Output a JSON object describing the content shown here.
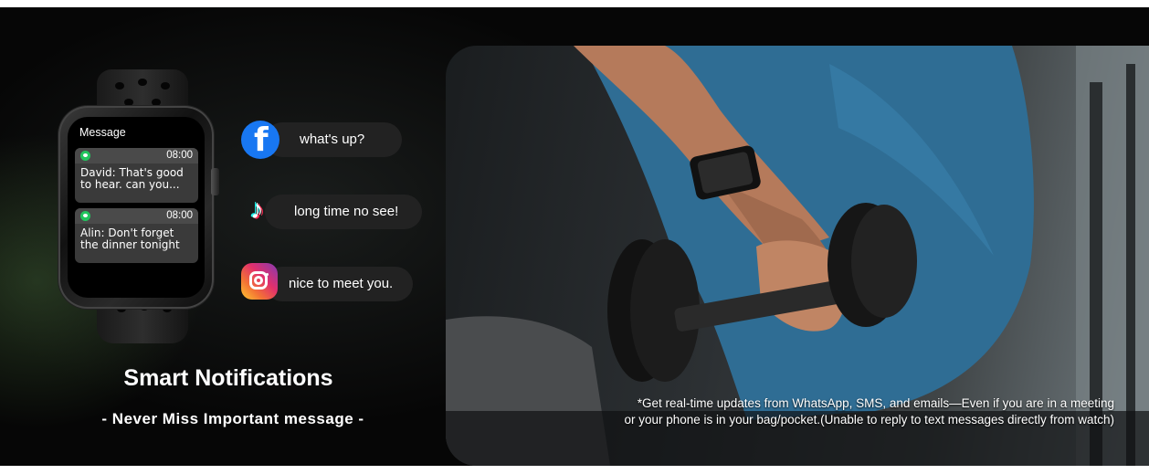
{
  "watch": {
    "screen_title": "Message",
    "notifications": [
      {
        "app_icon": "message-bubble-icon",
        "time": "08:00",
        "text": "David: That's good\nto hear. can you..."
      },
      {
        "app_icon": "message-bubble-icon",
        "time": "08:00",
        "text": "Alin: Don't forget\nthe dinner tonight"
      }
    ]
  },
  "chats": [
    {
      "icon": "facebook-icon",
      "text": "what's up?"
    },
    {
      "icon": "tiktok-icon",
      "text": "long time no see!"
    },
    {
      "icon": "instagram-icon",
      "text": "nice to meet you."
    }
  ],
  "heading": {
    "title": "Smart Notifications",
    "subtitle": "- Never Miss Important message -"
  },
  "caption": {
    "line1": "*Get real-time updates from WhatsApp, SMS, and emails—Even if you are in a meeting",
    "line2": "or your phone is in your bag/pocket.(Unable to reply to text messages directly from watch)"
  },
  "colors": {
    "facebook": "#1877f2",
    "notification_green": "#22c55e",
    "background": "#050505"
  }
}
